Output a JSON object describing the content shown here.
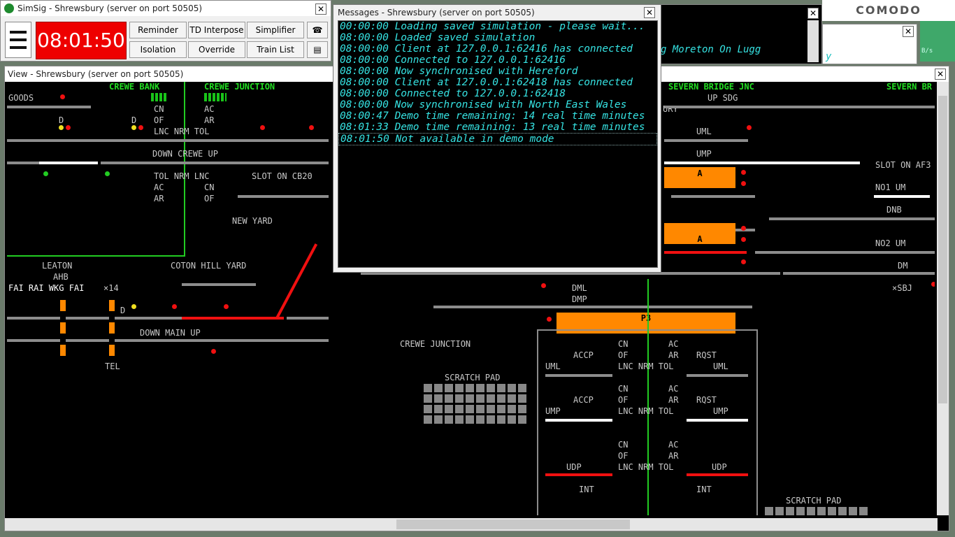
{
  "main_window": {
    "title": "SimSig - Shrewsbury (server on port 50505)",
    "clock": "08:01:50",
    "buttons": [
      "Reminder",
      "TD Interpose",
      "Simplifier",
      "Isolation",
      "Override",
      "Train List"
    ]
  },
  "messages_window": {
    "title": "Messages - Shrewsbury (server on port 50505)",
    "lines": [
      "00:00:00 Loading saved simulation - please wait...",
      "08:00:00 Loaded saved simulation",
      "08:00:00 Client at 127.0.0.1:62416 has connected",
      "08:00:00 Connected to 127.0.0.1:62416",
      "08:00:00 Now synchronised with Hereford",
      "08:00:00 Client at 127.0.0.1:62418 has connected",
      "08:00:00 Connected to 127.0.0.1:62418",
      "08:00:00 Now synchronised with North East Wales",
      "08:00:47 Demo time remaining: 14 real time minutes",
      "08:01:33 Demo time remaining: 13 real time minutes",
      "08:01:50 Not available in demo mode"
    ]
  },
  "bg_window": {
    "text": "g Moreton On Lugg",
    "text2": "y",
    "rate": "B/s"
  },
  "comodo": "COMODO",
  "view_window": {
    "title": "View - Shrewsbury (server on port 50505)",
    "labels": {
      "goods": "GOODS",
      "crewe_bank": "CREWE BANK",
      "crewe_junction_top": "CREWE JUNCTION",
      "cn1": "CN",
      "ac1": "AC",
      "of1": "OF",
      "ar1": "AR",
      "lnc_nrm_tol": "LNC NRM TOL",
      "down_crewe_up": "DOWN CREWE UP",
      "tol_nrm_lnc": "TOL NRM LNC",
      "slot_cb20": "SLOT ON CB20",
      "new_yard": "NEW YARD",
      "leaton": "LEATON",
      "ahb": "AHB",
      "fai_rai": "FAI RAI WKG FAI",
      "x14": "×14",
      "coton_hill": "COTON HILL YARD",
      "down_main_up": "DOWN MAIN UP",
      "tel": "TEL",
      "d1": "D",
      "d2": "D",
      "d3": "D",
      "crewe_junction_mid": "CREWE JUNCTION",
      "scratch_pad": "SCRATCH PAD",
      "scratch_pad2": "SCRATCH PAD",
      "dml": "DML",
      "dmp": "DMP",
      "p3": "P3",
      "severn_bridge": "SEVERN BRIDGE JNC",
      "severn_br": "SEVERN BR",
      "up_sdg": "UP SDG",
      "ury": "URY",
      "uml": "UML",
      "ump": "UMP",
      "slot_af3": "SLOT ON AF3",
      "no1_um": "NO1 UM",
      "dnb": "DNB",
      "no2_um": "NO2 UM",
      "dm": "DM",
      "xsbj": "×SBJ",
      "plat_a1": "A",
      "plat_a2": "A",
      "accp1": "ACCP",
      "rqst1": "RQST",
      "accp2": "ACCP",
      "rqst2": "RQST",
      "uml_l": "UML",
      "uml_r": "UML",
      "ump_l": "UMP",
      "ump_r": "UMP",
      "udp_l": "UDP",
      "udp_r": "UDP",
      "int_l": "INT",
      "int_r": "INT",
      "cn_a": "CN",
      "ac_a": "AC",
      "of_a": "OF",
      "ar_a": "AR",
      "lnc_a": "LNC NRM TOL",
      "cn_b": "CN",
      "ac_b": "AC",
      "of_b": "OF",
      "ar_b": "AR",
      "lnc_b": "LNC NRM TOL",
      "cn_c": "CN",
      "ac_c": "AC",
      "of_c": "OF",
      "ar_c": "AR",
      "lnc_c": "LNC NRM TOL",
      "ac_d": "AC",
      "ar_d": "AR",
      "cn_d": "CN",
      "of_d": "OF"
    }
  }
}
